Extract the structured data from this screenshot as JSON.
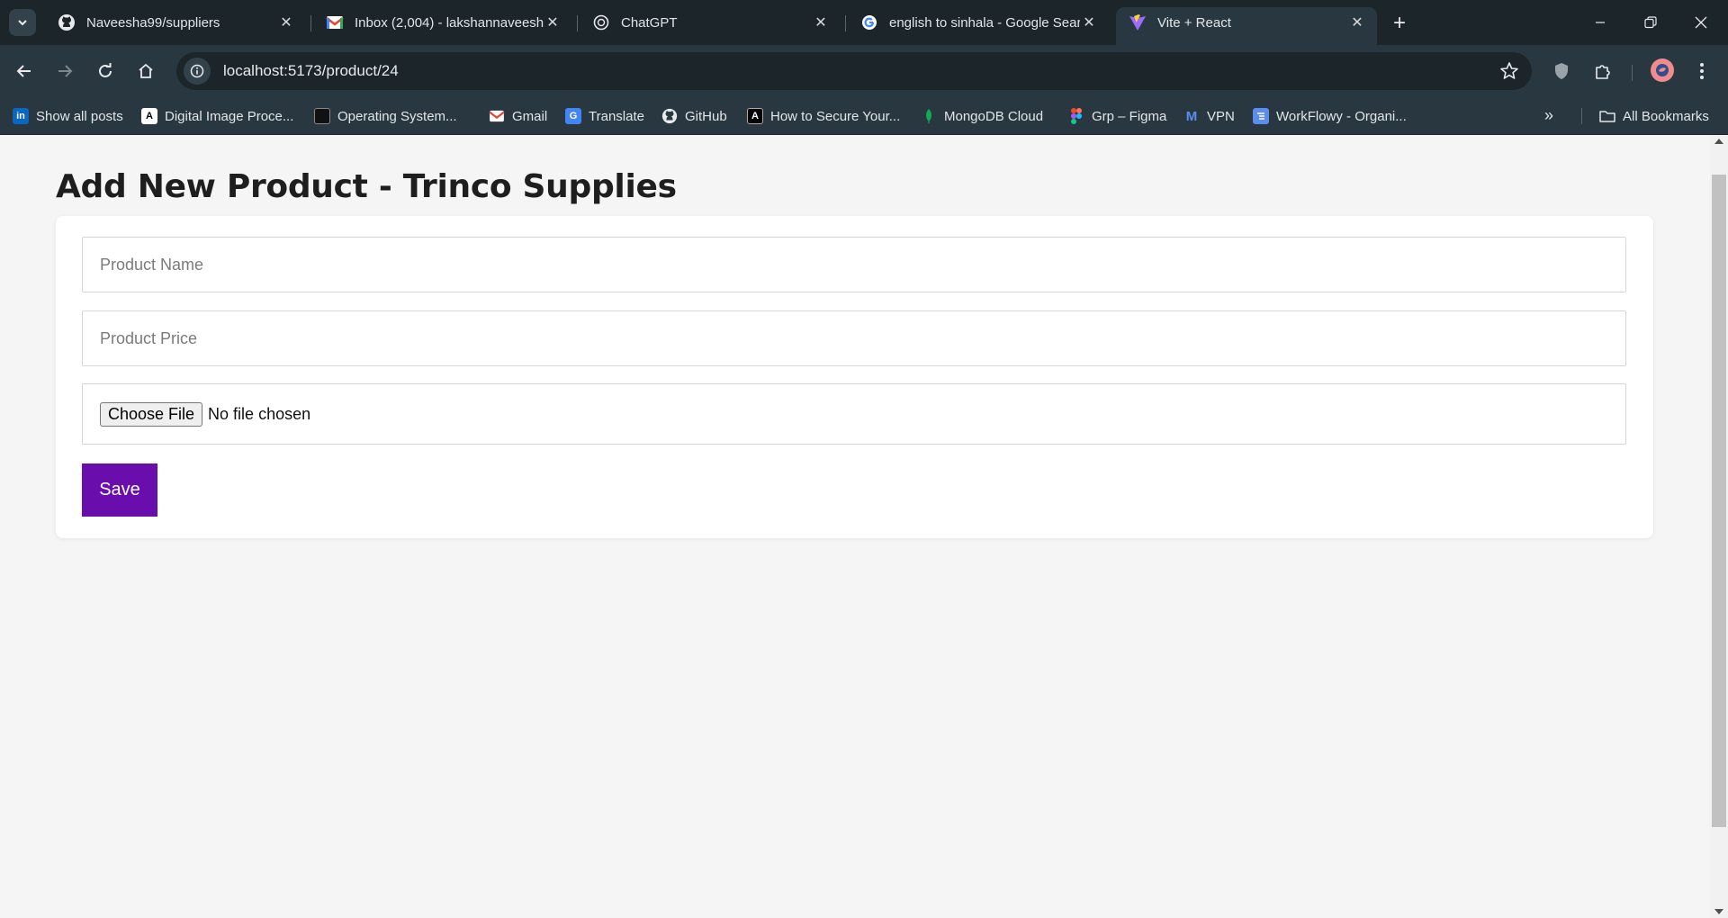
{
  "browser": {
    "tabs": [
      {
        "title": "Naveesha99/suppliers",
        "icon": "github-icon"
      },
      {
        "title": "Inbox (2,004) - lakshannaveesha",
        "icon": "gmail-icon"
      },
      {
        "title": "ChatGPT",
        "icon": "chatgpt-icon"
      },
      {
        "title": "english to sinhala - Google Sear",
        "icon": "google-icon"
      },
      {
        "title": "Vite + React",
        "icon": "vite-icon",
        "active": true
      }
    ],
    "url": "localhost:5173/product/24",
    "bookmarks": [
      {
        "label": "Show all posts",
        "icon": "linkedin-icon"
      },
      {
        "label": "Digital Image Proce...",
        "icon": "letter-a-icon"
      },
      {
        "label": "Operating System...",
        "icon": "book-icon"
      },
      {
        "label": "Gmail",
        "icon": "gmail-icon"
      },
      {
        "label": "Translate",
        "icon": "translate-icon"
      },
      {
        "label": "GitHub",
        "icon": "github-icon"
      },
      {
        "label": "How to Secure Your...",
        "icon": "bracket-a-icon"
      },
      {
        "label": "MongoDB Cloud",
        "icon": "mongodb-leaf-icon"
      },
      {
        "label": "Grp – Figma",
        "icon": "figma-icon"
      },
      {
        "label": "VPN",
        "icon": "gmail-icon"
      },
      {
        "label": "WorkFlowy - Organi...",
        "icon": "workflowy-icon"
      }
    ],
    "all_bookmarks_label": "All Bookmarks"
  },
  "page": {
    "title": "Add New Product - Trinco Supplies",
    "form": {
      "name_placeholder": "Product Name",
      "name_value": "",
      "price_placeholder": "Product Price",
      "price_value": "",
      "file_button": "Choose File",
      "file_status": "No file chosen",
      "save_label": "Save"
    }
  },
  "colors": {
    "accent": "#6a0dad",
    "page_bg": "#f5f5f5",
    "chrome_dark": "#1b252a",
    "chrome_toolbar": "#293840"
  }
}
